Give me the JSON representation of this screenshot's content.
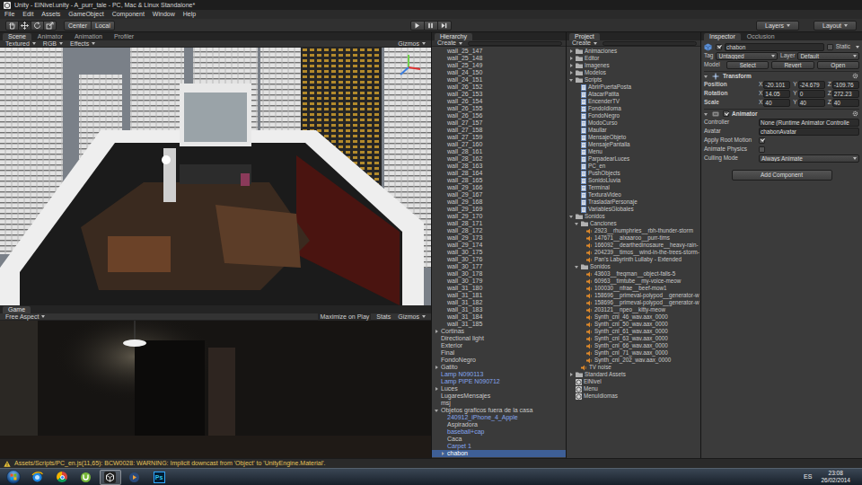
{
  "window": {
    "title": "Unity - ElNivel.unity - A_purr_tale - PC, Mac & Linux Standalone*"
  },
  "menu": [
    "File",
    "Edit",
    "Assets",
    "GameObject",
    "Component",
    "Window",
    "Help"
  ],
  "toolbar": {
    "tools": [
      {
        "selected": false
      },
      {
        "selected": true
      },
      {
        "selected": false
      },
      {
        "selected": false
      }
    ],
    "pivot": "Center",
    "space": "Local",
    "playing": false,
    "paused": false,
    "layers": "Layers",
    "layout": "Layout"
  },
  "scene": {
    "tabs": [
      {
        "label": "Scene",
        "selected": true
      },
      {
        "label": "Animator",
        "selected": false
      },
      {
        "label": "Animation",
        "selected": false
      },
      {
        "label": "Profiler",
        "selected": false
      }
    ],
    "controls": [
      "Textured",
      "RGB",
      "Effects"
    ],
    "gizmos": "Gizmos"
  },
  "game": {
    "tabs": [
      {
        "label": "Game",
        "selected": true
      }
    ],
    "aspect": "Free Aspect",
    "maximize": "Maximize on Play",
    "maximize_on": true,
    "stats": "Stats",
    "gizmos": "Gizmos"
  },
  "hierarchy": {
    "title": "Hierarchy",
    "create": "Create",
    "continued_children": [
      {
        "label": "wall_25_147",
        "prefab": false,
        "selected": false
      },
      {
        "label": "wall_25_148",
        "prefab": false,
        "selected": false
      },
      {
        "label": "wall_25_149",
        "prefab": false,
        "selected": false
      },
      {
        "label": "wall_24_150",
        "prefab": false,
        "selected": false
      },
      {
        "label": "wall_24_151",
        "prefab": false,
        "selected": false
      },
      {
        "label": "wall_26_152",
        "prefab": false,
        "selected": false
      },
      {
        "label": "wall_26_153",
        "prefab": false,
        "selected": false
      },
      {
        "label": "wall_26_154",
        "prefab": false,
        "selected": false
      },
      {
        "label": "wall_26_155",
        "prefab": false,
        "selected": false
      },
      {
        "label": "wall_26_156",
        "prefab": false,
        "selected": false
      },
      {
        "label": "wall_27_157",
        "prefab": false,
        "selected": false
      },
      {
        "label": "wall_27_158",
        "prefab": false,
        "selected": false
      },
      {
        "label": "wall_27_159",
        "prefab": false,
        "selected": false
      },
      {
        "label": "wall_27_160",
        "prefab": false,
        "selected": false
      },
      {
        "label": "wall_28_161",
        "prefab": false,
        "selected": false
      },
      {
        "label": "wall_28_162",
        "prefab": false,
        "selected": false
      },
      {
        "label": "wall_28_163",
        "prefab": false,
        "selected": false
      },
      {
        "label": "wall_28_164",
        "prefab": false,
        "selected": false
      },
      {
        "label": "wall_28_165",
        "prefab": false,
        "selected": false
      },
      {
        "label": "wall_29_166",
        "prefab": false,
        "selected": false
      },
      {
        "label": "wall_29_167",
        "prefab": false,
        "selected": false
      },
      {
        "label": "wall_29_168",
        "prefab": false,
        "selected": false
      },
      {
        "label": "wall_29_169",
        "prefab": false,
        "selected": false
      },
      {
        "label": "wall_29_170",
        "prefab": false,
        "selected": false
      },
      {
        "label": "wall_28_171",
        "prefab": false,
        "selected": false
      },
      {
        "label": "wall_28_172",
        "prefab": false,
        "selected": false
      },
      {
        "label": "wall_29_173",
        "prefab": false,
        "selected": false
      },
      {
        "label": "wall_29_174",
        "prefab": false,
        "selected": false
      },
      {
        "label": "wall_30_175",
        "prefab": false,
        "selected": false
      },
      {
        "label": "wall_30_176",
        "prefab": false,
        "selected": false
      },
      {
        "label": "wall_30_177",
        "prefab": false,
        "selected": false
      },
      {
        "label": "wall_30_178",
        "prefab": false,
        "selected": false
      },
      {
        "label": "wall_30_179",
        "prefab": false,
        "selected": false
      },
      {
        "label": "wall_31_180",
        "prefab": false,
        "selected": false
      },
      {
        "label": "wall_31_181",
        "prefab": false,
        "selected": false
      },
      {
        "label": "wall_31_182",
        "prefab": false,
        "selected": false
      },
      {
        "label": "wall_31_183",
        "prefab": false,
        "selected": false
      },
      {
        "label": "wall_31_184",
        "prefab": false,
        "selected": false
      },
      {
        "label": "wall_31_185",
        "prefab": false,
        "selected": false
      }
    ],
    "items": [
      {
        "label": "Cortinas",
        "expanded": false,
        "prefab": false,
        "selected": false
      },
      {
        "label": "Directional light",
        "prefab": false,
        "selected": false
      },
      {
        "label": "Exterior",
        "prefab": false,
        "selected": false
      },
      {
        "label": "Final",
        "prefab": false,
        "selected": false
      },
      {
        "label": "FondoNegro",
        "prefab": false,
        "selected": false
      },
      {
        "label": "Gatito",
        "expanded": false,
        "prefab": false,
        "selected": false
      },
      {
        "label": "Lamp N090113",
        "prefab": true,
        "selected": false
      },
      {
        "label": "Lamp PIPE N090712",
        "prefab": true,
        "selected": false
      },
      {
        "label": "Luces",
        "expanded": false,
        "prefab": false,
        "selected": false
      },
      {
        "label": "LugaresMensajes",
        "prefab": false,
        "selected": false
      },
      {
        "label": "msj",
        "prefab": false,
        "selected": false
      },
      {
        "label": "Objetos graficos fuera de la casa",
        "expanded": true,
        "prefab": false,
        "selected": false,
        "children": [
          {
            "label": "240912_iPhone_4_Apple",
            "prefab": true,
            "selected": false
          },
          {
            "label": "Aspiradora",
            "prefab": false,
            "selected": false
          },
          {
            "label": "baseball+cap",
            "prefab": true,
            "selected": false
          },
          {
            "label": "Caca",
            "prefab": false,
            "selected": false
          },
          {
            "label": "Carpet 1",
            "prefab": true,
            "selected": false
          },
          {
            "label": "chabon",
            "expanded": false,
            "prefab": false,
            "selected": true
          }
        ]
      }
    ]
  },
  "project": {
    "title": "Project",
    "create": "Create",
    "items": [
      {
        "label": "Animaciones",
        "kind": "folder",
        "expanded": false,
        "selected": false
      },
      {
        "label": "Editor",
        "kind": "folder",
        "expanded": false,
        "selected": false
      },
      {
        "label": "Imagenes",
        "kind": "folder",
        "expanded": false,
        "selected": false
      },
      {
        "label": "Modelos",
        "kind": "folder",
        "expanded": false,
        "selected": false
      },
      {
        "label": "Scripts",
        "kind": "folder",
        "expanded": true,
        "selected": false,
        "children": [
          {
            "label": "AbrirPuertaPosta",
            "kind": "script",
            "selected": false
          },
          {
            "label": "AtacarPatita",
            "kind": "script",
            "selected": false
          },
          {
            "label": "EncenderTV",
            "kind": "script",
            "selected": false
          },
          {
            "label": "FondoIdioma",
            "kind": "script",
            "selected": false
          },
          {
            "label": "FondoNegro",
            "kind": "script",
            "selected": false
          },
          {
            "label": "ModoCurso",
            "kind": "script",
            "selected": false
          },
          {
            "label": "Maullar",
            "kind": "script",
            "selected": false
          },
          {
            "label": "MensajeObjeto",
            "kind": "script",
            "selected": false
          },
          {
            "label": "MensajePantalla",
            "kind": "script",
            "selected": false
          },
          {
            "label": "Menu",
            "kind": "script",
            "selected": false
          },
          {
            "label": "ParpadearLuces",
            "kind": "script",
            "selected": false
          },
          {
            "label": "PC_en",
            "kind": "script",
            "selected": false
          },
          {
            "label": "PushObjects",
            "kind": "script",
            "selected": false
          },
          {
            "label": "SonidoLluvia",
            "kind": "script",
            "selected": false
          },
          {
            "label": "Terminal",
            "kind": "script",
            "selected": false
          },
          {
            "label": "TexturaVideo",
            "kind": "script",
            "selected": false
          },
          {
            "label": "TrasladarPersonaje",
            "kind": "script",
            "selected": false
          },
          {
            "label": "VariablesGlobales",
            "kind": "script",
            "selected": false
          }
        ]
      },
      {
        "label": "Sonidos",
        "kind": "folder",
        "expanded": true,
        "selected": false,
        "children": [
          {
            "label": "Canciones",
            "kind": "folder",
            "expanded": true,
            "selected": false,
            "children": [
              {
                "label": "2923__rhumphries__rbh-thunder-storm",
                "kind": "audio",
                "selected": false
              },
              {
                "label": "147671__aixaaroo__purr-tims",
                "kind": "audio",
                "selected": false
              },
              {
                "label": "166092__dearthedinosaure__heavy-rain-",
                "kind": "audio",
                "selected": false
              },
              {
                "label": "204239__timos__wind-in-the-trees-storm-",
                "kind": "audio",
                "selected": false
              },
              {
                "label": "Pan's Labyrinth Lullaby - Extended",
                "kind": "audio",
                "selected": false
              }
            ]
          },
          {
            "label": "Sonidos",
            "kind": "folder",
            "expanded": true,
            "selected": false,
            "children": [
              {
                "label": "43603__freqman__object-falls-5",
                "kind": "audio",
                "selected": false
              },
              {
                "label": "60963__timtube__my-voice-meow",
                "kind": "audio",
                "selected": false
              },
              {
                "label": "100030__nfrae__beef-mow1",
                "kind": "audio",
                "selected": false
              },
              {
                "label": "158696__primeval-polypod__generator-w",
                "kind": "audio",
                "selected": false
              },
              {
                "label": "158696__primeval-polypod__generator-w",
                "kind": "audio",
                "selected": false
              },
              {
                "label": "203121__npeo__kitty-meow",
                "kind": "audio",
                "selected": false
              },
              {
                "label": "Synth_cnl_46_wav.aax_0000",
                "kind": "audio",
                "selected": false
              },
              {
                "label": "Synth_cnl_50_wav.aax_0000",
                "kind": "audio",
                "selected": false
              },
              {
                "label": "Synth_cnl_61_wav.aax_0000",
                "kind": "audio",
                "selected": false
              },
              {
                "label": "Synth_cnl_63_wav.aax_0000",
                "kind": "audio",
                "selected": false
              },
              {
                "label": "Synth_cnl_66_wav.aax_0000",
                "kind": "audio",
                "selected": false
              },
              {
                "label": "Synth_cnl_71_wav.aax_0000",
                "kind": "audio",
                "selected": false
              },
              {
                "label": "Synth_cnl_202_wav.aax_0000",
                "kind": "audio",
                "selected": false
              }
            ]
          },
          {
            "label": "TV noise",
            "kind": "audio",
            "selected": false
          }
        ]
      },
      {
        "label": "Standard Assets",
        "kind": "folder",
        "expanded": false,
        "selected": false
      },
      {
        "label": "ElNivel",
        "kind": "scene",
        "selected": false
      },
      {
        "label": "Menu",
        "kind": "scene",
        "selected": false
      },
      {
        "label": "MenuIdiomas",
        "kind": "scene",
        "selected": false
      }
    ]
  },
  "inspector": {
    "tabs": [
      {
        "label": "Inspector",
        "selected": true
      },
      {
        "label": "Occlusion",
        "selected": false
      }
    ],
    "object": {
      "active": true,
      "name": "chabon",
      "static": false,
      "static_label": "Static",
      "tag_label": "Tag",
      "tag": "Untagged",
      "layer_label": "Layer",
      "layer": "Default",
      "model_label": "Model",
      "model_buttons": [
        "Select",
        "Revert",
        "Open"
      ]
    },
    "transform": {
      "title": "Transform",
      "expanded": true,
      "rows": [
        {
          "label": "Position",
          "axes": [
            {
              "axis": "X",
              "value": "-20.101"
            },
            {
              "axis": "Y",
              "value": "-24.679"
            },
            {
              "axis": "Z",
              "value": "-109.76"
            }
          ]
        },
        {
          "label": "Rotation",
          "axes": [
            {
              "axis": "X",
              "value": "14.05"
            },
            {
              "axis": "Y",
              "value": "0"
            },
            {
              "axis": "Z",
              "value": "272.23"
            }
          ]
        },
        {
          "label": "Scale",
          "axes": [
            {
              "axis": "X",
              "value": "40"
            },
            {
              "axis": "Y",
              "value": "40"
            },
            {
              "axis": "Z",
              "value": "40"
            }
          ]
        }
      ]
    },
    "animator": {
      "title": "Animator",
      "expanded": true,
      "enabled": true,
      "fields": [
        {
          "label": "Controller",
          "kind": "object",
          "value": "None (Runtime Animator Controlle"
        },
        {
          "label": "Avatar",
          "kind": "object",
          "value": "chabonAvatar"
        },
        {
          "label": "Apply Root Motion",
          "kind": "toggle",
          "checked": true
        },
        {
          "label": "Animate Physics",
          "kind": "toggle",
          "checked": false
        },
        {
          "label": "Culling Mode",
          "kind": "dropdown",
          "value": "Always Animate"
        }
      ]
    },
    "add_component": "Add Component"
  },
  "status": {
    "message": "Assets/Scripts/PC_en.js(11,65): BCW0028: WARNING: Implicit downcast from 'Object' to 'UnityEngine.Material'."
  },
  "taskbar": {
    "apps": [
      {
        "selected": false
      },
      {
        "selected": false
      },
      {
        "selected": false
      },
      {
        "selected": true
      },
      {
        "selected": false
      },
      {
        "selected": false,
        "label": "Ps"
      }
    ],
    "language": "ES",
    "time": "23:08",
    "date": "26/02/2014"
  }
}
